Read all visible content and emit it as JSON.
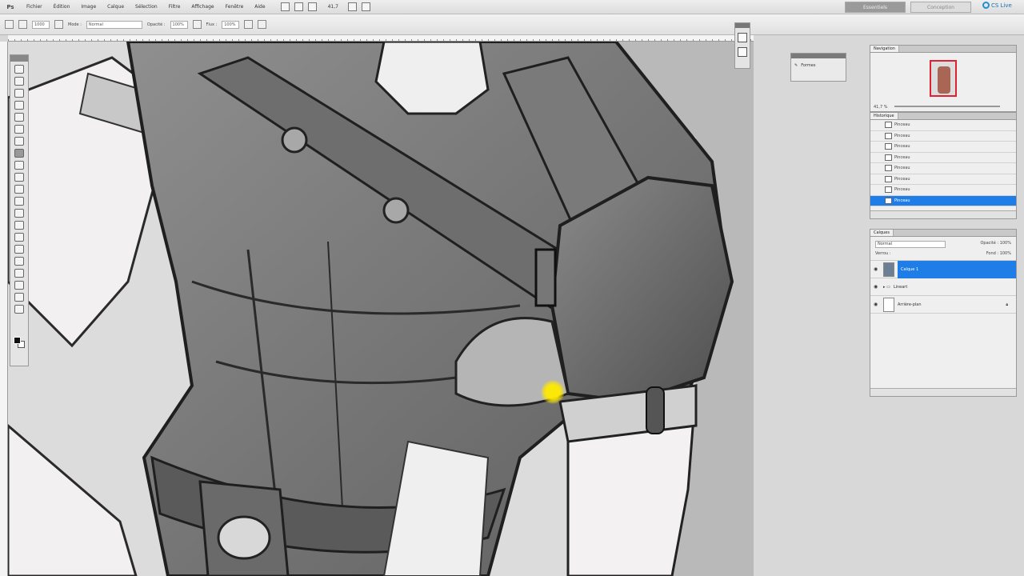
{
  "menubar": {
    "logo": "Ps",
    "items": [
      "Fichier",
      "Édition",
      "Image",
      "Calque",
      "Sélection",
      "Filtre",
      "Affichage",
      "Fenêtre",
      "Aide"
    ],
    "zoom": "41,7",
    "workspace_active": "Essentiels",
    "workspace_other": "Conception",
    "cs_live": "CS Live"
  },
  "options": {
    "brush_size": "1000",
    "mode": "Normal",
    "opacity_label": "Opacité :",
    "opacity": "100%",
    "flow_label": "Flux :",
    "flow": "100%"
  },
  "small_panel": {
    "label": "Formes"
  },
  "navigator": {
    "tab": "Navigation",
    "zoom": "41,7 %"
  },
  "history": {
    "tab": "Historique",
    "items": [
      "Pinceau",
      "Pinceau",
      "Pinceau",
      "Pinceau",
      "Pinceau",
      "Pinceau",
      "Pinceau",
      "Pinceau"
    ]
  },
  "layers": {
    "tab": "Calques",
    "blend": "Normal",
    "opacity": "Opacité : 100%",
    "lock": "Verrou :",
    "fill": "Fond : 100%",
    "rows": [
      {
        "name": "Calque 1",
        "selected": true
      },
      {
        "name": "Lineart",
        "selected": false
      },
      {
        "name": "Arrière-plan",
        "selected": false
      }
    ]
  },
  "colors": {
    "selection_blue": "#1f7de8",
    "cursor_highlight": "#ffe600"
  }
}
